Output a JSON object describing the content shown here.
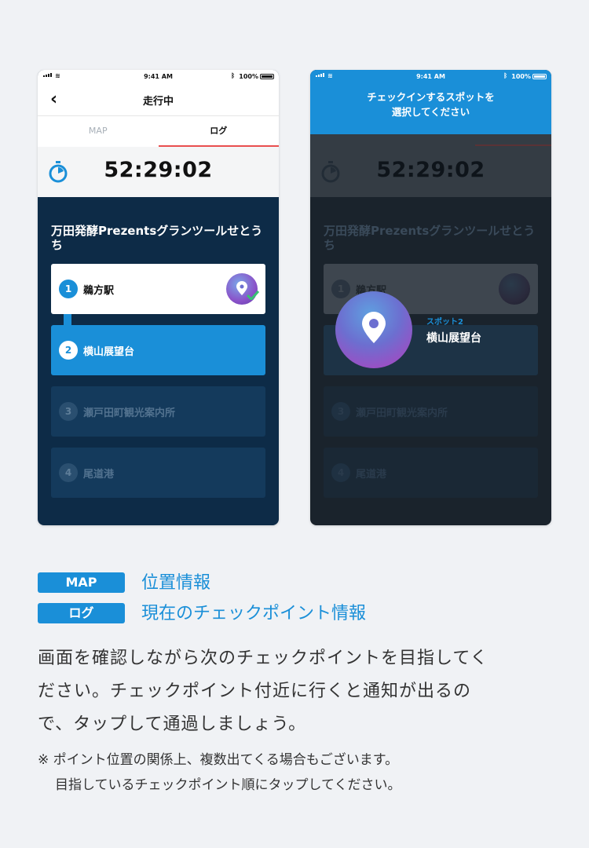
{
  "statusbar": {
    "time": "9:41 AM",
    "battery": "100%"
  },
  "phone1": {
    "header_title": "走行中",
    "tabs": {
      "map": "MAP",
      "log": "ログ"
    },
    "timer": "52:29:02",
    "course_title": "万田発酵Prezentsグランツールせとうち",
    "spots": [
      {
        "num": "1",
        "name": "鵜方駅",
        "state": "done"
      },
      {
        "num": "2",
        "name": "横山展望台",
        "state": "active"
      },
      {
        "num": "3",
        "name": "瀬戸田町観光案内所",
        "state": "pending"
      },
      {
        "num": "4",
        "name": "尾道港",
        "state": "pending"
      }
    ]
  },
  "phone2": {
    "message": "チェックインするスポットを\n選択してください",
    "timer": "52:29:02",
    "course_title": "万田発酵Prezentsグランツールせとうち",
    "spots": [
      {
        "num": "1",
        "name": "鵜方駅"
      },
      {
        "num": "3",
        "name": "瀬戸田町観光案内所"
      },
      {
        "num": "4",
        "name": "尾道港"
      }
    ],
    "popup": {
      "label": "スポット2",
      "name": "横山展望台"
    }
  },
  "legend": [
    {
      "tag": "MAP",
      "desc": "位置情報"
    },
    {
      "tag": "ログ",
      "desc": "現在のチェックポイント情報"
    }
  ],
  "description": {
    "line1": "画面を確認しながら次のチェックポイントを目指してく",
    "line2": "ださい。チェックポイント付近に行くと通知が出るの",
    "line3": "で、タップして通過しましょう。"
  },
  "note": {
    "line1": "※ ポイント位置の関係上、複数出てくる場合もございます。",
    "line2": "目指しているチェックポイント順にタップしてください。"
  },
  "colors": {
    "accent": "#1a8fd8",
    "tab_underline": "#e94f4f",
    "phone_bg": "#0d2b47"
  }
}
